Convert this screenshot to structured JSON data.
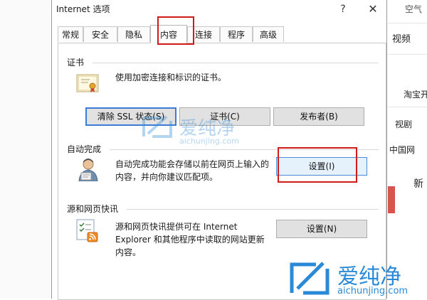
{
  "dialog": {
    "title": "Internet 选项",
    "help_glyph": "?",
    "close_glyph": "✕",
    "tabs": [
      {
        "label": "常规"
      },
      {
        "label": "安全"
      },
      {
        "label": "隐私"
      },
      {
        "label": "内容",
        "active": true
      },
      {
        "label": "连接"
      },
      {
        "label": "程序"
      },
      {
        "label": "高级"
      }
    ]
  },
  "certificates": {
    "heading": "证书",
    "description": "使用加密连接和标识的证书。",
    "clear_ssl_label": "清除 SSL 状态(S)",
    "certificates_label": "证书(C)",
    "publishers_label": "发布者(B)"
  },
  "autocomplete": {
    "heading": "自动完成",
    "description_line1": "自动完成功能会存储以前在网页上输入的",
    "description_line2": "内容，并向你建议匹配项。",
    "settings_label": "设置(I)"
  },
  "feeds": {
    "heading": "源和网页快讯",
    "description_line1": "源和网页快讯提供可在 Internet",
    "description_line2": "Explorer 和其他程序中读取的网站更新",
    "description_line3": "内容。",
    "settings_label": "设置(N)"
  },
  "background_browser": {
    "items": [
      "空气",
      "视频",
      "淘宝开",
      "视剧",
      "中国网",
      "新"
    ]
  },
  "watermark": {
    "brand": "爱纯净",
    "url": "aichunjing.com"
  },
  "colors": {
    "highlight": "#d11b1b",
    "focus": "#3d7bd6",
    "watermark": "#2b8ad8"
  }
}
